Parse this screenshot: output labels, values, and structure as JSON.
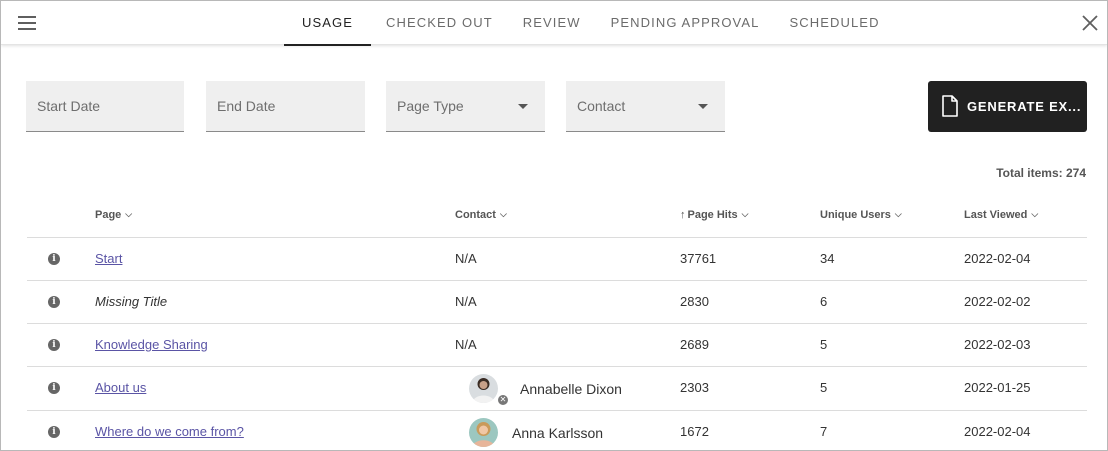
{
  "tabs": [
    {
      "label": "Usage",
      "active": true
    },
    {
      "label": "Checked out",
      "active": false
    },
    {
      "label": "Review",
      "active": false
    },
    {
      "label": "Pending approval",
      "active": false
    },
    {
      "label": "Scheduled",
      "active": false
    }
  ],
  "filters": {
    "start_date": "Start Date",
    "end_date": "End Date",
    "page_type": "Page Type",
    "contact": "Contact"
  },
  "generate_button": "GENERATE EX...",
  "total_items": "Total items: 274",
  "columns": {
    "page": "Page",
    "contact": "Contact",
    "page_hits": "Page Hits",
    "unique_users": "Unique Users",
    "last_viewed": "Last Viewed"
  },
  "rows": [
    {
      "page": "Start",
      "contact": "N/A",
      "hits": "37761",
      "users": "34",
      "last": "2022-02-04"
    },
    {
      "page": "Missing Title",
      "contact": "N/A",
      "hits": "2830",
      "users": "6",
      "last": "2022-02-02"
    },
    {
      "page": "Knowledge Sharing",
      "contact": "N/A",
      "hits": "2689",
      "users": "5",
      "last": "2022-02-03"
    },
    {
      "page": "About us",
      "contact": "Annabelle Dixon",
      "hits": "2303",
      "users": "5",
      "last": "2022-01-25"
    },
    {
      "page": "Where do we come from?",
      "contact": "Anna Karlsson",
      "hits": "1672",
      "users": "7",
      "last": "2022-02-04"
    }
  ],
  "icons": {
    "menu": "hamburger-menu-icon",
    "close": "close-icon",
    "document": "document-icon",
    "info": "info-icon",
    "sort_ascending": "arrow-up-icon",
    "chevron": "chevron-down-icon"
  },
  "colors": {
    "link": "#5a54a5",
    "active_tab_underline": "#222222",
    "button_bg": "#212121",
    "field_bg": "#efefef"
  }
}
